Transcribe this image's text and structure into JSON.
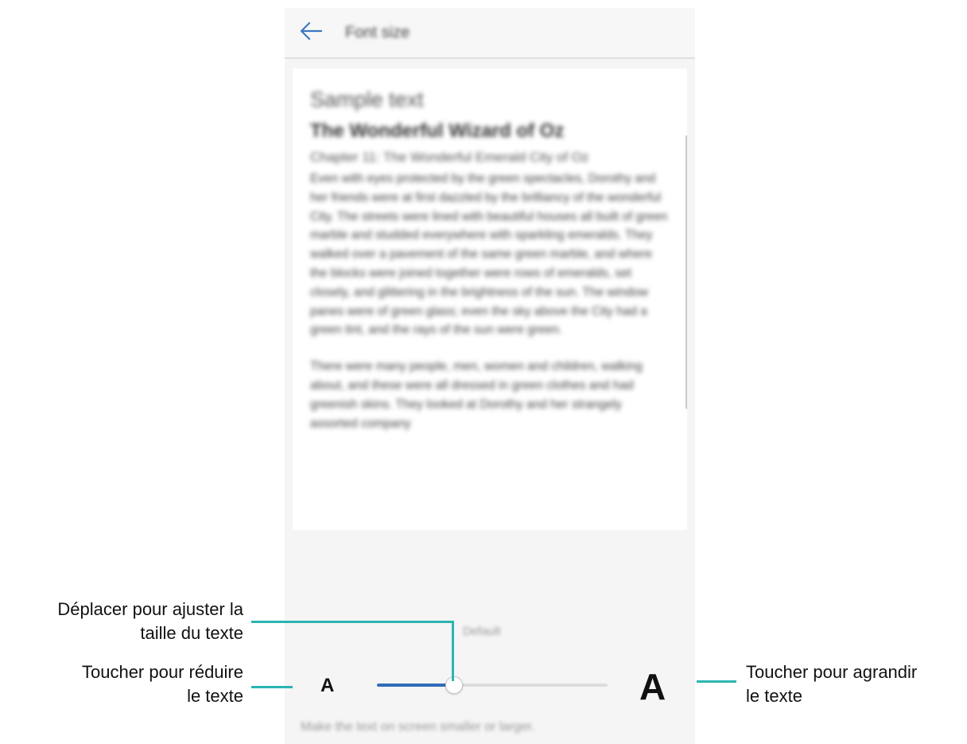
{
  "colors": {
    "accent": "#2f6db8",
    "callout_line": "#2bb5b0"
  },
  "app_bar": {
    "back_icon": "back-arrow-icon",
    "title": "Font size"
  },
  "preview": {
    "sample_title": "Sample text",
    "book_title": "The Wonderful Wizard of Oz",
    "chapter": "Chapter 11: The Wonderful Emerald City of Oz",
    "paragraph_1": "Even with eyes protected by the green spectacles, Dorothy and her friends were at first dazzled by the brilliancy of the wonderful City. The streets were lined with beautiful houses all built of green marble and studded everywhere with sparkling emeralds. They walked over a pavement of the same green marble, and where the blocks were joined together were rows of emeralds, set closely, and glittering in the brightness of the sun. The window panes were of green glass; even the sky above the City had a green tint, and the rays of the sun were green.",
    "paragraph_2": "There were many people, men, women and children, walking about, and these were all dressed in green clothes and had greenish skins. They looked at Dorothy and her strangely assorted company"
  },
  "slider": {
    "default_label": "Default",
    "decrease_label": "A",
    "increase_label": "A",
    "level": 0.33
  },
  "hint": "Make the text on screen smaller or larger.",
  "callouts": {
    "slider_line1": "Déplacer pour ajuster la",
    "slider_line2": "taille du texte",
    "decrease_line1": "Toucher pour réduire",
    "decrease_line2": "le texte",
    "increase_line1": "Toucher pour agrandir",
    "increase_line2": "le texte"
  }
}
